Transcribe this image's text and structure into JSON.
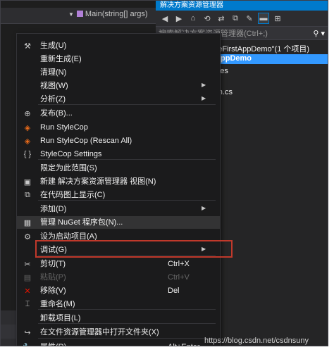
{
  "editor": {
    "member_dropdown": "Main(string[] args)"
  },
  "solution_explorer": {
    "title": "解决方案资源管理器",
    "search_placeholder": "搜索解决方案资源管理器(Ctrl+;)",
    "tree": [
      "odeFirstAppDemo\"(1 个项目)",
      "rstAppDemo",
      "erties",
      "ram.cs"
    ]
  },
  "context_menu": {
    "items": [
      {
        "label": "生成(U)",
        "icon": "build-icon"
      },
      {
        "label": "重新生成(E)",
        "icon": ""
      },
      {
        "label": "清理(N)",
        "icon": ""
      },
      {
        "label": "视图(W)",
        "icon": "",
        "submenu": true
      },
      {
        "label": "分析(Z)",
        "icon": "",
        "submenu": true
      },
      {
        "label": "发布(B)...",
        "icon": "publish-icon"
      },
      {
        "label": "Run StyleCop",
        "icon": "stylecop-icon"
      },
      {
        "label": "Run StyleCop (Rescan All)",
        "icon": "stylecop-icon"
      },
      {
        "label": "StyleCop Settings",
        "icon": "braces-icon"
      },
      {
        "label": "限定为此范围(S)",
        "icon": ""
      },
      {
        "label": "新建 解决方案资源管理器 视图(N)",
        "icon": "new-view-icon"
      },
      {
        "label": "在代码图上显示(C)",
        "icon": "code-map-icon"
      },
      {
        "label": "添加(D)",
        "icon": "",
        "submenu": true
      },
      {
        "label": "管理 NuGet 程序包(N)...",
        "icon": "nuget-icon"
      },
      {
        "label": "设为启动项目(A)",
        "icon": "gear-icon"
      },
      {
        "label": "调试(G)",
        "icon": "",
        "submenu": true
      },
      {
        "label": "剪切(T)",
        "icon": "cut-icon",
        "shortcut": "Ctrl+X"
      },
      {
        "label": "粘贴(P)",
        "icon": "paste-icon",
        "shortcut": "Ctrl+V",
        "disabled": true
      },
      {
        "label": "移除(V)",
        "icon": "remove-icon",
        "shortcut": "Del"
      },
      {
        "label": "重命名(M)",
        "icon": "rename-icon"
      },
      {
        "label": "卸载项目(L)",
        "icon": ""
      },
      {
        "label": "在文件资源管理器中打开文件夹(X)",
        "icon": "open-folder-icon"
      },
      {
        "label": "属性(R)",
        "icon": "wrench-icon",
        "shortcut": "Alt+Enter"
      }
    ]
  },
  "watermark": "https://blog.csdn.net/csdnsuny",
  "colors": {
    "accent": "#007acc",
    "highlight_box": "#c0392b",
    "menu_bg": "#1b1b1c"
  }
}
